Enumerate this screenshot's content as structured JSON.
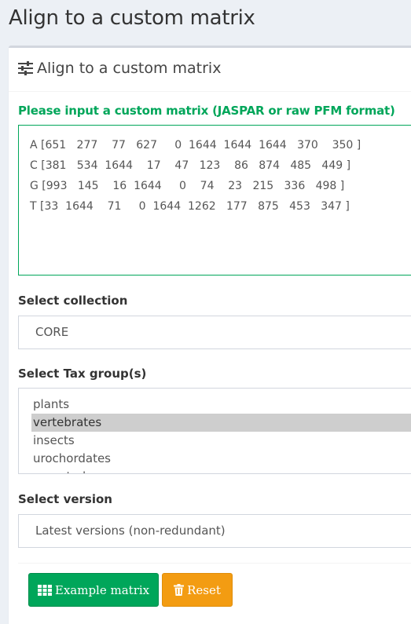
{
  "page": {
    "title": "Align to a custom matrix"
  },
  "box": {
    "title": "Align to a custom matrix"
  },
  "matrix": {
    "label": "Please input a custom matrix (JASPAR or raw PFM format)",
    "value": "A [651   277    77   627     0  1644  1644  1644   370    350 ]\nC [381   534  1644    17    47   123    86   874   485   449 ]\nG [993   145    16  1644     0    74    23   215   336   498 ]\nT [33  1644    71     0  1644  1262   177   875   453   347 ]"
  },
  "collection": {
    "label": "Select collection",
    "value": "CORE"
  },
  "tax_group": {
    "label": "Select Tax group(s)",
    "options": [
      "plants",
      "vertebrates",
      "insects",
      "urochordates",
      "nematodes"
    ],
    "selected": "vertebrates"
  },
  "version": {
    "label": "Select version",
    "value": "Latest versions (non-redundant)"
  },
  "buttons": {
    "example_label": "Example matrix",
    "reset_label": "Reset"
  },
  "colors": {
    "green": "#00a65a",
    "orange": "#f39c12",
    "selected_bg": "#cecece"
  }
}
